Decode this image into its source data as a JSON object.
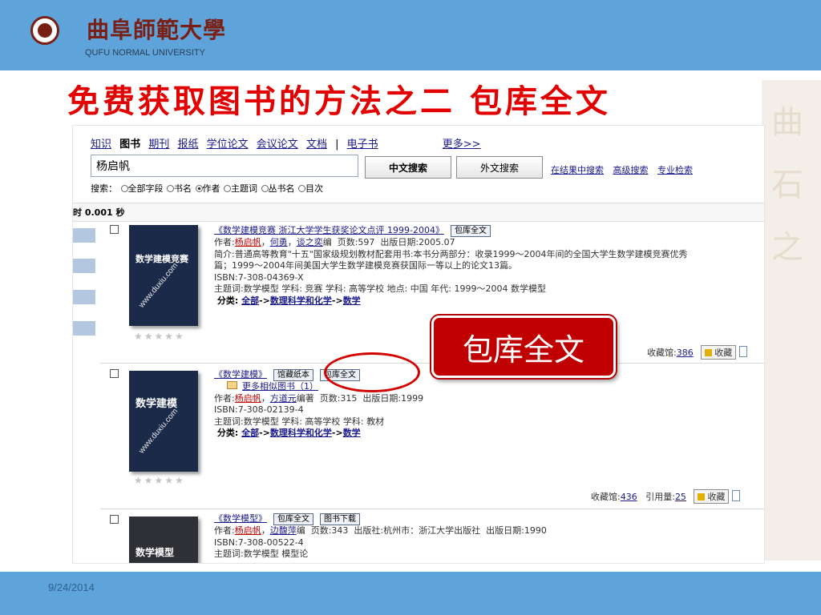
{
  "header": {
    "university_cn": "曲阜師範大學",
    "university_en": "QUFU NORMAL UNIVERSITY"
  },
  "slide": {
    "title": "免费获取图书的方法之二 包库全文",
    "callout": "包库全文",
    "date": "9/24/2014"
  },
  "deco_chars": [
    "曲",
    "石",
    "之"
  ],
  "nav": {
    "items": [
      "知识",
      "图书",
      "期刊",
      "报纸",
      "学位论文",
      "会议论文",
      "文档",
      "电子书"
    ],
    "active": "图书",
    "separator": "|",
    "more": "更多>>"
  },
  "search": {
    "value": "杨启帆",
    "btn_chinese": "中文搜索",
    "btn_foreign": "外文搜索",
    "links": [
      "在结果中搜索",
      "高级搜索",
      "专业检索"
    ],
    "field_label": "搜索：",
    "fields": [
      "全部字段",
      "书名",
      "作者",
      "主题词",
      "丛书名",
      "目次"
    ],
    "selected_field": "作者"
  },
  "timing": "时 0.001 秒",
  "results": [
    {
      "title": "《数学建模竞赛 浙江大学学生获奖论文点评 1999-2004》",
      "tags": [
        "包库全文"
      ],
      "author_label": "作者:",
      "authors": [
        "杨启帆",
        "何勇",
        "谈之奕"
      ],
      "author_suffix": "编",
      "pages": "页数:597",
      "pub_date": "出版日期:2005.07",
      "intro_1": "简介:普通高等教育\"十五\"国家级规划教材配套用书:本书分两部分：收录1999～2004年间的全国大学生数学建模竞赛优秀",
      "intro_2": "篇；1999～2004年间美国大学生数学建模竞赛获国际一等以上的论文13篇。",
      "isbn": "ISBN:7-308-04369-X",
      "subject": "主题词:数学模型 学科: 竞赛 学科: 高等学校 地点: 中国 年代: 1999～2004 数学模型",
      "class_label": "分类:",
      "class_path": [
        "全部",
        "数理科学和化学",
        "数学"
      ],
      "holdings_label": "收藏馆:",
      "holdings": "386",
      "fav_label": "收藏",
      "cover_title": "数学建模竞赛",
      "cover_url": "www.duxiu.com",
      "stars": "★★★★★"
    },
    {
      "title": "《数学建模》",
      "tags": [
        "馆藏纸本",
        "包库全文"
      ],
      "similar": "更多相似图书（1）",
      "author_label": "作者:",
      "authors": [
        "杨启帆",
        "方道元"
      ],
      "author_suffix": "编著",
      "pages": "页数:315",
      "pub_date": "出版日期:1999",
      "isbn": "ISBN:7-308-02139-4",
      "subject": "主题词:数学模型 学科: 高等学校 学科: 教材",
      "class_label": "分类:",
      "class_path": [
        "全部",
        "数理科学和化学",
        "数学"
      ],
      "holdings_label": "收藏馆:",
      "holdings": "436",
      "citation_label": "引用量:",
      "citations": "25",
      "fav_label": "收藏",
      "cover_title": "数学建模",
      "cover_url": "www.duxiu.com",
      "stars": "★★★★★"
    },
    {
      "title": "《数学模型》",
      "tags": [
        "包库全文",
        "图书下载"
      ],
      "author_label": "作者:",
      "authors": [
        "杨启帆",
        "边馥萍"
      ],
      "author_suffix": "编",
      "pages": "页数:343",
      "publisher": "出版社:杭州市：浙江大学出版社",
      "pub_date": "出版日期:1990",
      "isbn": "ISBN:7-308-00522-4",
      "subject": "主题词:数学模型 模型论",
      "cover_title": "数学模型"
    }
  ]
}
